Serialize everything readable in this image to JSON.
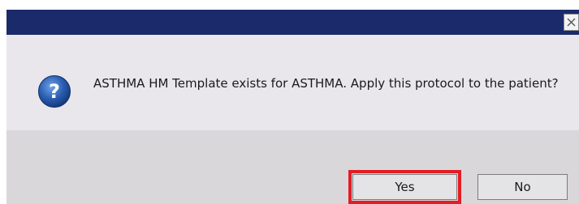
{
  "dialog": {
    "message": "ASTHMA HM Template exists for ASTHMA.  Apply this protocol to the patient?",
    "icon": "question-icon",
    "close_icon": "close-icon"
  },
  "buttons": {
    "yes_label": "Yes",
    "no_label": "No"
  },
  "colors": {
    "titlebar": "#1a2a6b",
    "body": "#e9e7ec",
    "button_bar": "#d9d7da",
    "highlight": "#e21d26",
    "icon_blue": "#2a5db0"
  }
}
